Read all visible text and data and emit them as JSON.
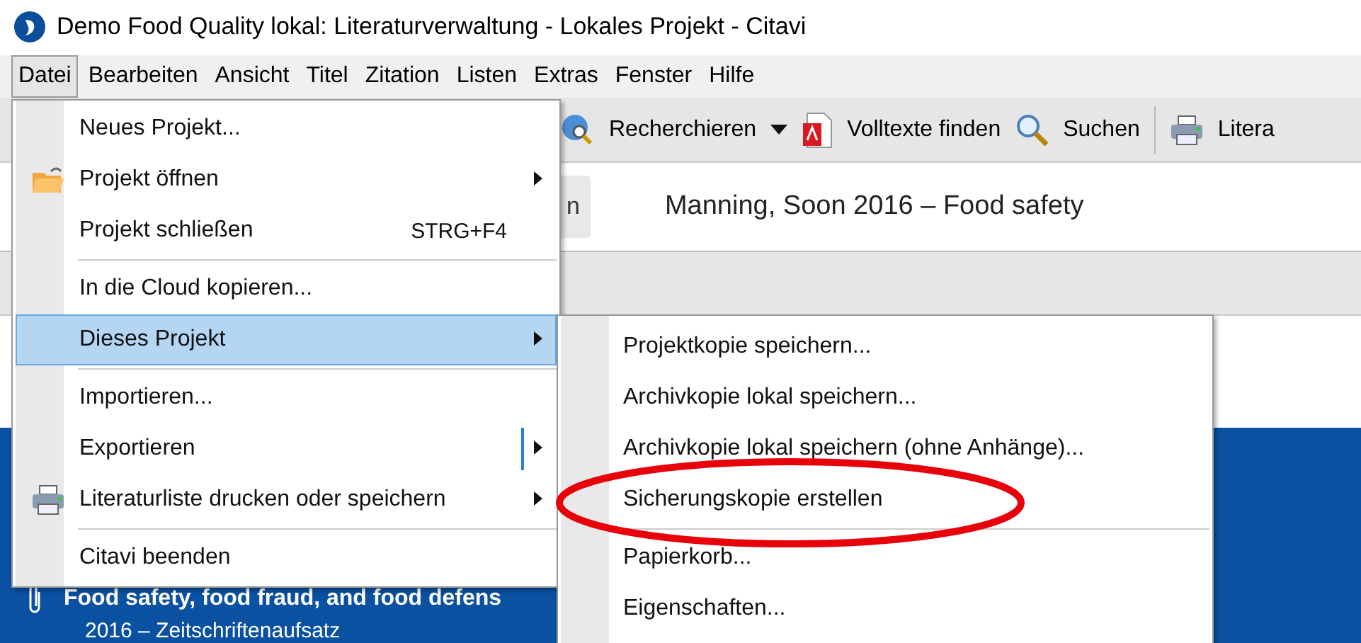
{
  "window": {
    "title": "Demo Food Quality lokal: Literaturverwaltung - Lokales Projekt - Citavi"
  },
  "menubar": [
    {
      "label": "Datei",
      "selected": true
    },
    {
      "label": "Bearbeiten",
      "selected": false
    },
    {
      "label": "Ansicht",
      "selected": false
    },
    {
      "label": "Titel",
      "selected": false
    },
    {
      "label": "Zitation",
      "selected": false
    },
    {
      "label": "Listen",
      "selected": false
    },
    {
      "label": "Extras",
      "selected": false
    },
    {
      "label": "Fenster",
      "selected": false
    },
    {
      "label": "Hilfe",
      "selected": false
    }
  ],
  "toolbar": [
    {
      "kind": "globe",
      "label": "Recherchieren",
      "dropdown": true
    },
    {
      "kind": "pdf",
      "label": "Volltexte finden",
      "dropdown": false
    },
    {
      "kind": "search",
      "label": "Suchen",
      "dropdown": false
    },
    {
      "kind": "separator"
    },
    {
      "kind": "printer",
      "label": "Litera",
      "dropdown": false
    }
  ],
  "header": {
    "button": "n",
    "title": "Manning, Soon 2016 – Food safety"
  },
  "reference_list": [
    {
      "title": "Food safety, food fraud, and food defens",
      "subtitle": "2016 – Zeitschriftenaufsatz",
      "attachment": true,
      "selected": true
    }
  ],
  "file_menu": [
    {
      "kind": "item",
      "label": "Neues Projekt...",
      "selected": false,
      "submenu": false
    },
    {
      "kind": "folder",
      "label": "Projekt öffnen",
      "selected": false,
      "submenu": true
    },
    {
      "kind": "item",
      "label": "Projekt schließen",
      "shortcut": "STRG+F4",
      "selected": false,
      "submenu": false
    },
    {
      "kind": "separator"
    },
    {
      "kind": "item",
      "label": "In die Cloud kopieren...",
      "selected": false,
      "submenu": false
    },
    {
      "kind": "item",
      "label": "Dieses Projekt",
      "selected": true,
      "submenu": true
    },
    {
      "kind": "separator"
    },
    {
      "kind": "item",
      "label": "Importieren...",
      "selected": false,
      "submenu": false
    },
    {
      "kind": "item",
      "label": "Exportieren",
      "selected": false,
      "submenu": true,
      "split": true
    },
    {
      "kind": "printer",
      "label": "Literaturliste drucken oder speichern",
      "selected": false,
      "submenu": true
    },
    {
      "kind": "separator"
    },
    {
      "kind": "item",
      "label": "Citavi beenden",
      "selected": false,
      "submenu": false
    }
  ],
  "project_submenu": [
    {
      "kind": "item",
      "label": "Projektkopie speichern...",
      "highlighted": false
    },
    {
      "kind": "item",
      "label": "Archivkopie lokal speichern...",
      "highlighted": false
    },
    {
      "kind": "item",
      "label": "Archivkopie lokal speichern (ohne Anhänge)...",
      "highlighted": false
    },
    {
      "kind": "item",
      "label": "Sicherungskopie erstellen",
      "highlighted": true
    },
    {
      "kind": "separator"
    },
    {
      "kind": "item",
      "label": "Papierkorb...",
      "highlighted": false
    },
    {
      "kind": "item",
      "label": "Eigenschaften...",
      "highlighted": false
    }
  ]
}
